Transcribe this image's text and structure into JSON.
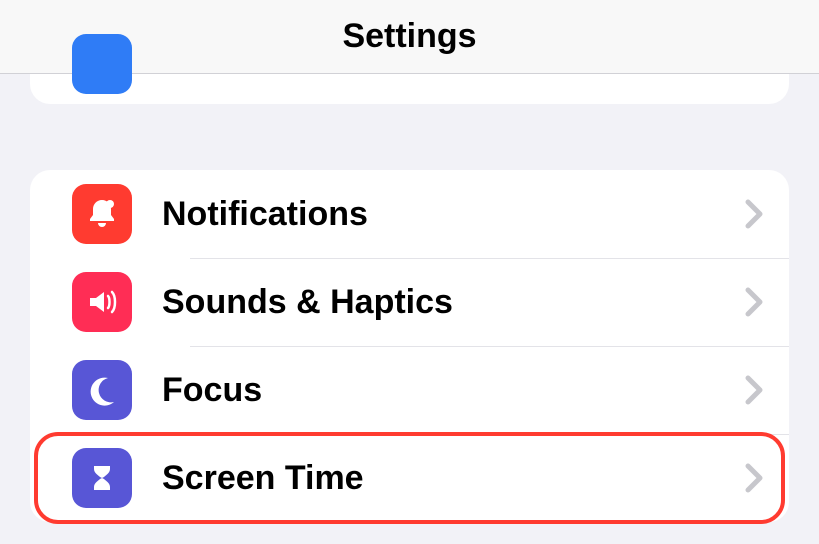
{
  "header": {
    "title": "Settings"
  },
  "rows": [
    {
      "label": "Notifications",
      "icon": "bell-icon",
      "color": "#ff3b30"
    },
    {
      "label": "Sounds & Haptics",
      "icon": "speaker-icon",
      "color": "#ff2d55"
    },
    {
      "label": "Focus",
      "icon": "moon-icon",
      "color": "#5856d6"
    },
    {
      "label": "Screen Time",
      "icon": "hourglass-icon",
      "color": "#5856d6"
    }
  ],
  "highlighted_row_index": 3
}
